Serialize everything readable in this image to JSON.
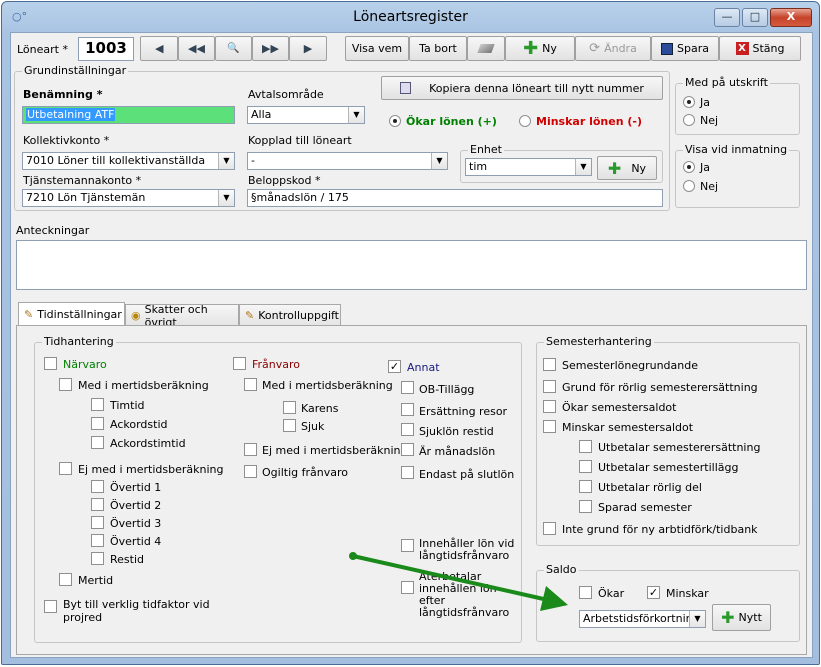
{
  "window": {
    "title": "Löneartsregister",
    "min": "—",
    "max": "□",
    "close": "X"
  },
  "toolbar": {
    "loneart_label": "Löneart",
    "loneart_value": "1003",
    "visa_vem": "Visa vem",
    "ta_bort": "Ta bort",
    "ny": "Ny",
    "andra": "Ändra",
    "spara": "Spara",
    "stang": "Stäng",
    "first": "◀",
    "prev": "◀◀",
    "search": "🔍",
    "next": "▶▶",
    "last": "▶"
  },
  "grund": {
    "title": "Grundinställningar",
    "benamning_label": "Benämning",
    "benamning_value": "Utbetalning ATF",
    "avtal_label": "Avtalsområde",
    "avtal_value": "Alla",
    "kopiera": "Kopiera denna löneart till nytt nummer",
    "okar": "Ökar lönen (+)",
    "minskar": "Minskar lönen (-)",
    "kollektiv_label": "Kollektivkonto",
    "kollektiv_value": "7010 Löner till kollektivanställda",
    "kopplad_label": "Kopplad till löneart",
    "kopplad_value": "-",
    "enhet_label": "Enhet",
    "enhet_value": "tim",
    "enhet_ny": "Ny",
    "tjm_label": "Tjänstemannakonto",
    "tjm_value": "7210 Lön Tjänstemän",
    "belopp_label": "Beloppskod",
    "belopp_value": "§månadslön / 175"
  },
  "utskrift": {
    "title": "Med på utskrift",
    "ja": "Ja",
    "nej": "Nej"
  },
  "inmatning": {
    "title": "Visa vid inmatning",
    "ja": "Ja",
    "nej": "Nej"
  },
  "anteckningar": {
    "label": "Anteckningar",
    "value": ""
  },
  "tabs": [
    {
      "label": "Tidinställningar"
    },
    {
      "label": "Skatter och övrigt"
    },
    {
      "label": "Kontrolluppgift"
    }
  ],
  "tid": {
    "title": "Tidhantering",
    "narvaro": "Närvaro",
    "med1": "Med i mertidsberäkning",
    "timtid": "Timtid",
    "ackordstid": "Ackordstid",
    "ackordstimtid": "Ackordstimtid",
    "ejmed1": "Ej med i mertidsberäkning",
    "ov1": "Övertid 1",
    "ov2": "Övertid 2",
    "ov3": "Övertid 3",
    "ov4": "Övertid 4",
    "restid": "Restid",
    "mertid": "Mertid",
    "byt": "Byt till verklig tidfaktor vid projred",
    "franvaro": "Frånvaro",
    "med2": "Med i mertidsberäkning",
    "karens": "Karens",
    "sjuk": "Sjuk",
    "ejmed2": "Ej med i mertidsberäkning",
    "ogiltig": "Ogiltig frånvaro",
    "annat": "Annat",
    "ob": "OB-Tillägg",
    "ersattning": "Ersättning resor",
    "sjuklon": "Sjuklön restid",
    "manadslon": "Är månadslön",
    "slutlon": "Endast på slutlön",
    "innehaller": "Innehåller lön vid långtidsfrånvaro",
    "atobetalar": "Återbetalar innehållen lön efter långtidsfrånvaro"
  },
  "sem": {
    "title": "Semesterhantering",
    "s1": "Semesterlönegrundande",
    "s2": "Grund för rörlig semesterersättning",
    "s3": "Ökar semestersaldot",
    "s4": "Minskar semestersaldot",
    "s5": "Utbetalar semesterersättning",
    "s6": "Utbetalar semestertillägg",
    "s7": "Utbetalar rörlig del",
    "s8": "Sparad semester",
    "s9": "Inte grund för ny arbtidförk/tidbank"
  },
  "saldo": {
    "title": "Saldo",
    "okar": "Ökar",
    "minskar": "Minskar",
    "value": "Arbetstidsförkortning",
    "nytt": "Nytt"
  },
  "colors": {
    "benamning_bg": "#5be07a",
    "okar": "#008000",
    "minskar": "#d00000",
    "franvaro": "#8b0000",
    "annat": "#1a1a80",
    "arrow": "#1a8a1a"
  }
}
